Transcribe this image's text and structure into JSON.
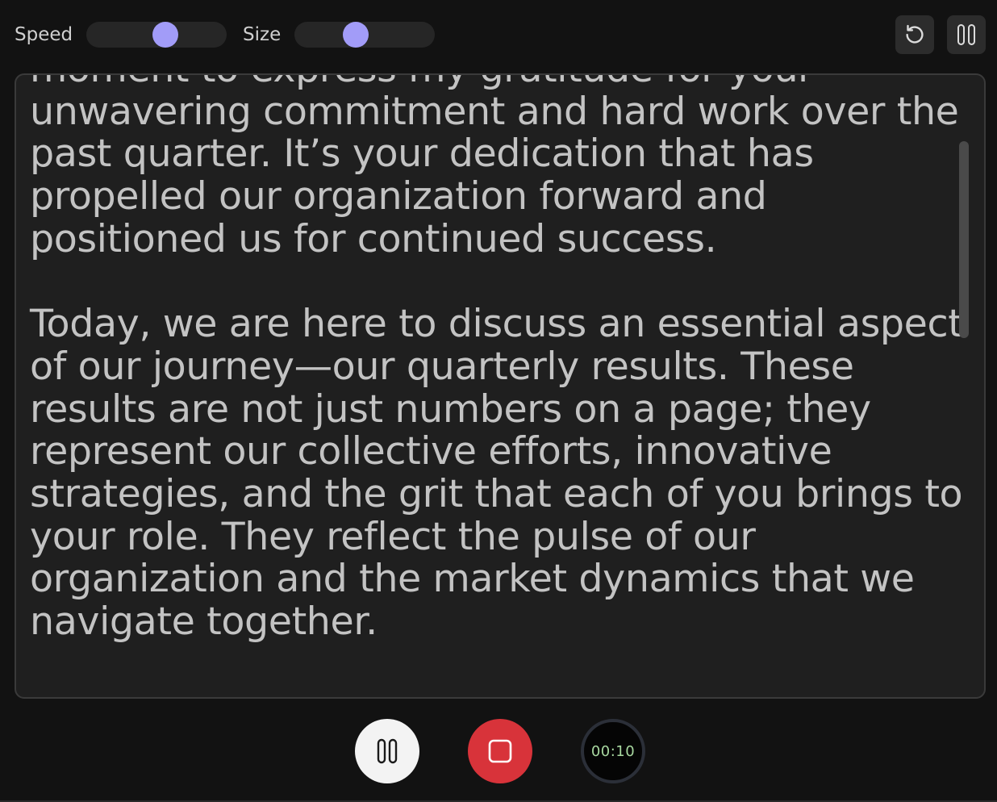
{
  "toolbar": {
    "speed_label": "Speed",
    "size_label": "Size",
    "speed_value": 0.58,
    "size_value": 0.42,
    "reset_icon": "rotate-ccw-icon",
    "pause_icon": "pause-icon"
  },
  "script": {
    "paragraphs": [
      "moment to express my gratitude for your unwavering commitment and hard work over the past quarter. It’s your dedication that has propelled our organization forward and positioned us for continued success.",
      "Today, we are here to discuss an essential aspect of our journey—our quarterly results. These results are not just numbers on a page; they represent our collective efforts, innovative strategies, and the grit that each of you brings to your role. They reflect the pulse of our organization and the market dynamics that we navigate together."
    ]
  },
  "controls": {
    "pause_icon": "pause-icon",
    "stop_icon": "stop-icon",
    "timer": "00:10"
  },
  "colors": {
    "accent": "#a29cf8",
    "stop": "#d8333a",
    "timer_text": "#a8d8a0"
  }
}
